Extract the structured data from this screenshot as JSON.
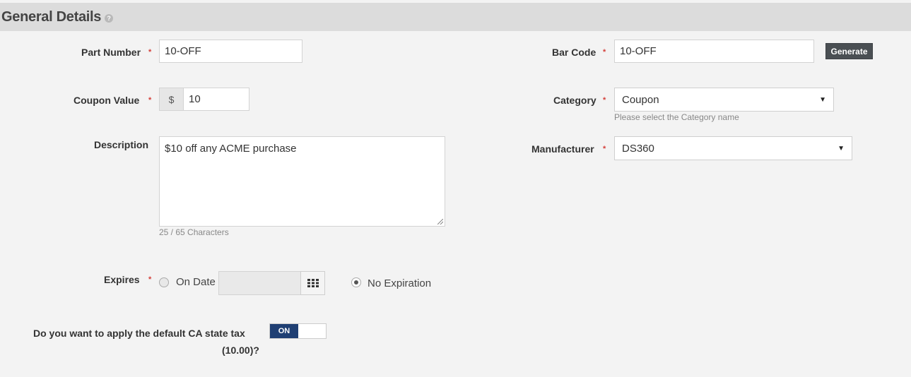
{
  "header": {
    "title": "General Details",
    "help_icon": "question-circle-icon"
  },
  "required_marker": "*",
  "fields": {
    "part_number": {
      "label": "Part Number",
      "value": "10-OFF"
    },
    "bar_code": {
      "label": "Bar Code",
      "value": "10-OFF",
      "generate_label": "Generate"
    },
    "coupon_value": {
      "label": "Coupon Value",
      "currency": "$",
      "value": "10"
    },
    "category": {
      "label": "Category",
      "value": "Coupon",
      "hint": "Please select the Category name"
    },
    "description": {
      "label": "Description",
      "value": "$10 off any ACME purchase",
      "counter": "25 / 65 Characters"
    },
    "manufacturer": {
      "label": "Manufacturer",
      "value": "DS360"
    },
    "expires": {
      "label": "Expires",
      "options": [
        {
          "label": "On Date",
          "checked": false
        },
        {
          "label": "No Expiration",
          "checked": true
        }
      ],
      "calendar_icon": "calendar-grid-icon"
    },
    "tax": {
      "label_line1": "Do you want to apply the default CA state tax",
      "label_line2": "(10.00)?",
      "toggle_label": "ON",
      "toggle_on": true
    }
  },
  "colors": {
    "accent": "#1f3f73",
    "required": "#d43f3a",
    "header_bg": "#dcdcdc",
    "button": "#4a4f53"
  }
}
